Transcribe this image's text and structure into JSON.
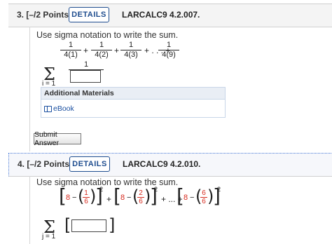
{
  "q3": {
    "number": "3.",
    "points": "[–/2 Points]",
    "details_label": "DETAILS",
    "code": "LARCALC9 4.2.007.",
    "prompt": "Use sigma notation to write the sum.",
    "terms": [
      {
        "num": "1",
        "den": "4(1)"
      },
      {
        "num": "1",
        "den": "4(2)"
      },
      {
        "num": "1",
        "den": "4(3)"
      },
      {
        "num": "1",
        "den": "4(9)"
      }
    ],
    "plus": "+",
    "ellipsis": "+ . . . +",
    "answer_num": "1",
    "sigma": "Σ",
    "lower_index": "i = 1",
    "additional_materials": "Additional Materials",
    "ebook_label": "eBook",
    "submit_label": "Submit Answer"
  },
  "q4": {
    "number": "4.",
    "points": "[–/2 Points]",
    "details_label": "DETAILS",
    "code": "LARCALC9 4.2.010.",
    "prompt": "Use sigma notation to write the sum.",
    "terms": [
      {
        "lead": "8",
        "minus": "−",
        "num": "1",
        "den": "6",
        "exp": "2"
      },
      {
        "lead": "8",
        "minus": "−",
        "num": "2",
        "den": "6",
        "exp": "2"
      },
      {
        "lead": "8",
        "minus": "−",
        "num": "6",
        "den": "6",
        "exp": "2"
      }
    ],
    "plus": "+",
    "ellipsis": "+ ... +",
    "sigma": "Σ",
    "lower_index": "j = 1"
  },
  "colors": {
    "accent": "#1f4d8f",
    "highlight": "#d62a1e",
    "link": "#1a4fa0"
  }
}
